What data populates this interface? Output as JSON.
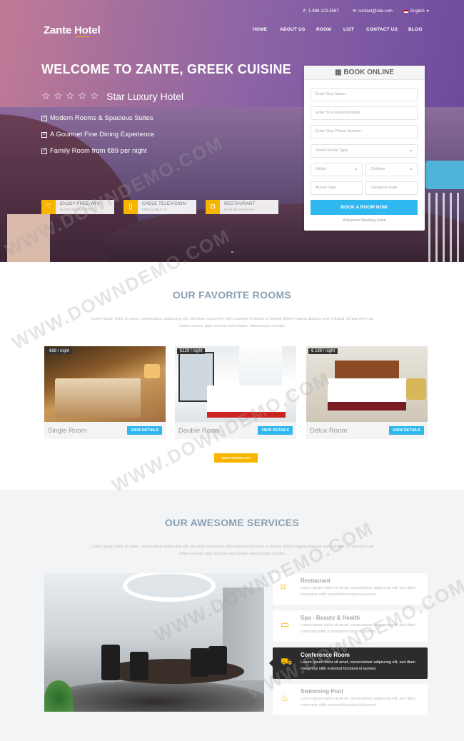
{
  "topbar": {
    "phone": "1-888-123-4567",
    "email": "contact@site.com",
    "language": "English"
  },
  "brand": {
    "name": "Zante Hotel",
    "accent": "#f7b500"
  },
  "nav": [
    "HOME",
    "ABOUT US",
    "ROOM",
    "LIST",
    "CONTACT US",
    "BLOG"
  ],
  "hero": {
    "title": "WELCOME TO ZANTE, GREEK CUISINE",
    "rating_text": "Star Luxury Hotel",
    "stars": 5,
    "features": [
      "Modern Rooms & Spacious Suites",
      "A Gourmet Fine Dining Experience",
      "Family Room from €89 per night"
    ],
    "amenities": [
      {
        "title": "ENJOY FREE WI-FI",
        "sub": "IN THE WHOLE HOTEL",
        "icon": "wifi-icon"
      },
      {
        "title": "CABLE TELEVISION",
        "sub": "FREE CABLE TV",
        "icon": "tv-icon"
      },
      {
        "title": "RESTAURANT",
        "sub": "MAIN RESTAURANT",
        "icon": "restaurant-icon"
      }
    ]
  },
  "booking": {
    "title": "BOOK ONLINE",
    "name_placeholder": "Enter Your Name",
    "email_placeholder": "Enter Your Email Address",
    "phone_placeholder": "Enter Your Phone Number",
    "room_type": "Select Room Type",
    "adults": "Adults",
    "children": "Children",
    "arrival": "Arrival Date",
    "departure": "Departure Date",
    "submit": "BOOK A ROOM NOW",
    "advanced": "Advanced Booking Form"
  },
  "rooms_section": {
    "title": "OUR FAVORITE ROOMS",
    "desc": "Lorem ipsum dolor sit amet, consectetuer adipiscing elit, sed diam nonummy nibh euismod tincidunt ut laoreet dolore magna aliquam erat volutpat. Ut wisi enim ad minim veniam, quis nostrud exerci tation ullamcorper suscipit.",
    "rooms": [
      {
        "price": "€89 / night",
        "name": "Single Room",
        "button": "VIEW DETAILS"
      },
      {
        "price": "€129 / night",
        "name": "Double Room",
        "button": "VIEW DETAILS"
      },
      {
        "price": "€ 189 / night",
        "name": "Delux Room",
        "button": "VIEW DETAILS"
      }
    ],
    "more_button": "VIEW ROOMS LIST"
  },
  "services_section": {
    "title": "OUR AWESOME SERVICES",
    "desc": "Lorem ipsum dolor sit amet, consectetuer adipiscing elit, sed diam nonummy nibh euismod tincidunt ut laoreet dolore magna aliquam erat volutpat. Ut wisi enim ad minim veniam, quis nostrud exerci tation ullamcorper suscipit.",
    "items": [
      {
        "title": "Restaurant",
        "desc": "Lorem ipsum dolor sit amet, consectetuer adipiscing elit, sed diam nonummy nibh euismod tincidunt ut laoreet.",
        "icon": "restaurant-icon"
      },
      {
        "title": "Spa - Beauty & Health",
        "desc": "Lorem ipsum dolor sit amet, consectetuer adipiscing elit, sed diam nonummy nibh euismod tincidunt ut laoreet.",
        "icon": "spa-icon"
      },
      {
        "title": "Conference Room",
        "desc": "Lorem ipsum dolor sit amet, consectetuer adipiscing elit, sed diam nonummy nibh euismod tincidunt ut laoreet.",
        "icon": "car-icon",
        "active": true
      },
      {
        "title": "Swimming Pool",
        "desc": "Lorem ipsum dolor sit amet, consectetuer adipiscing elit, sed diam nonummy nibh euismod tincidunt ut laoreet.",
        "icon": "pool-icon"
      }
    ]
  },
  "watermark": "WWW.DOWNDEMO.COM"
}
